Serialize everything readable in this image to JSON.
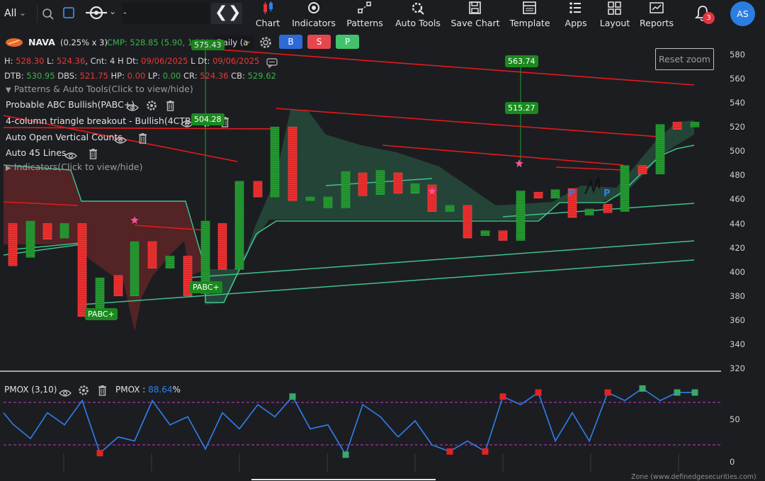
{
  "topbar": {
    "symbol_filter": "All",
    "search_value": "-",
    "menu": [
      {
        "label": "Chart",
        "icon": "candlestick-icon"
      },
      {
        "label": "Indicators",
        "icon": "indicators-icon"
      },
      {
        "label": "Patterns",
        "icon": "patterns-icon"
      },
      {
        "label": "Auto Tools",
        "icon": "auto-tools-icon"
      },
      {
        "label": "Save Chart",
        "icon": "save-icon"
      },
      {
        "label": "Template",
        "icon": "template-icon"
      },
      {
        "label": "Apps",
        "icon": "apps-icon"
      },
      {
        "label": "Layout",
        "icon": "layout-icon"
      },
      {
        "label": "Reports",
        "icon": "reports-icon"
      }
    ],
    "notification_count": "3",
    "avatar_initials": "AS"
  },
  "header": {
    "symbol": "NAVA",
    "multiplier": "(0.25% x 3)",
    "cmp": "CMP: 528.85 (5.90, 1.13%)",
    "timeframe": "Daily (a",
    "buttons": {
      "buy": "B",
      "sell": "S",
      "p": "P"
    }
  },
  "ohlc": {
    "h_label": "H:",
    "h": "528.30",
    "l_label": "L:",
    "l": "524.36",
    "cnt": "Cnt: 4",
    "hdt_label": "H Dt:",
    "hdt": "09/06/2025",
    "ldt_label": "L Dt:",
    "ldt": "09/06/2025",
    "dtb_label": "DTB:",
    "dtb": "530.95",
    "dbs_label": "DBS:",
    "dbs": "521.75",
    "hp_label": "HP:",
    "hp": "0.00",
    "lp_label": "LP:",
    "lp": "0.00",
    "cr_label": "CR:",
    "cr": "524.36",
    "cb_label": "CB:",
    "cb": "529.62"
  },
  "panels": {
    "patterns_toggle": "Patterns & Auto Tools(Click to view/hide)",
    "items": [
      "Probable ABC Bullish(PABC+)",
      "4-column triangle breakout - Bullish(4CTB+)",
      "Auto Open Vertical Counts",
      "Auto 45 Lines"
    ],
    "indicators_toggle": "Indicators(Click to view/hide)"
  },
  "reset_zoom": "Reset zoom",
  "y_axis": [
    "580",
    "560",
    "540",
    "520",
    "500",
    "480",
    "460",
    "440",
    "420",
    "400",
    "380",
    "360",
    "340",
    "320"
  ],
  "annotations": {
    "top_clip": "575.43",
    "mid_clip": "504.28",
    "v1": "563.74",
    "v2": "515.27",
    "pabc_a": "PABC+",
    "pabc_b": "PABC+",
    "p_mark": "P"
  },
  "pmox": {
    "label": "PMOX (3,10)",
    "value_label": "PMOX :",
    "value": "88.64",
    "unit": "%",
    "y_axis": [
      "50",
      "0"
    ]
  },
  "footer": "Zone (www.definedgesecurities.com)",
  "colors": {
    "bull": "#1e8c2a",
    "bear": "#e02424",
    "trend": "#e31b1b",
    "support": "#3ec28a",
    "pmox_line": "#2f80ed",
    "accent": "#1565c0"
  },
  "chart_data": {
    "type": "bar",
    "title": "",
    "ylim": [
      310,
      590
    ],
    "note_bars": [
      {
        "x": 0,
        "open": 440,
        "close": 405,
        "dir": "down"
      },
      {
        "x": 1,
        "open": 412,
        "close": 442,
        "dir": "up"
      },
      {
        "x": 2,
        "open": 440,
        "close": 427,
        "dir": "down"
      },
      {
        "x": 3,
        "open": 428,
        "close": 440,
        "dir": "up"
      },
      {
        "x": 4,
        "open": 440,
        "close": 363,
        "dir": "down"
      },
      {
        "x": 5,
        "open": 363,
        "close": 395,
        "dir": "up"
      },
      {
        "x": 6,
        "open": 380,
        "close": 397,
        "dir": "down"
      },
      {
        "x": 7,
        "open": 380,
        "close": 425,
        "dir": "up"
      },
      {
        "x": 8,
        "open": 425,
        "close": 403,
        "dir": "down"
      },
      {
        "x": 9,
        "open": 403,
        "close": 413,
        "dir": "up"
      },
      {
        "x": 10,
        "open": 413,
        "close": 380,
        "dir": "down"
      },
      {
        "x": 11,
        "open": 382,
        "close": 442,
        "dir": "up"
      },
      {
        "x": 12,
        "open": 440,
        "close": 402,
        "dir": "down"
      },
      {
        "x": 13,
        "open": 402,
        "close": 475,
        "dir": "up"
      },
      {
        "x": 14,
        "open": 475,
        "close": 462,
        "dir": "down"
      },
      {
        "x": 15,
        "open": 462,
        "close": 520,
        "dir": "up"
      },
      {
        "x": 16,
        "open": 520,
        "close": 459,
        "dir": "down"
      },
      {
        "x": 17,
        "open": 459,
        "close": 462,
        "dir": "up"
      },
      {
        "x": 18,
        "open": 462,
        "close": 453,
        "dir": "up"
      },
      {
        "x": 19,
        "open": 453,
        "close": 483,
        "dir": "up"
      },
      {
        "x": 20,
        "open": 482,
        "close": 463,
        "dir": "down"
      },
      {
        "x": 21,
        "open": 464,
        "close": 484,
        "dir": "up"
      },
      {
        "x": 22,
        "open": 482,
        "close": 465,
        "dir": "down"
      },
      {
        "x": 23,
        "open": 465,
        "close": 473,
        "dir": "up"
      },
      {
        "x": 24,
        "open": 472,
        "close": 450,
        "dir": "down"
      },
      {
        "x": 25,
        "open": 455,
        "close": 450,
        "dir": "up"
      },
      {
        "x": 26,
        "open": 455,
        "close": 428,
        "dir": "down"
      },
      {
        "x": 27,
        "open": 430,
        "close": 434,
        "dir": "up"
      },
      {
        "x": 28,
        "open": 434,
        "close": 426,
        "dir": "down"
      },
      {
        "x": 29,
        "open": 426,
        "close": 467,
        "dir": "up"
      },
      {
        "x": 30,
        "open": 466,
        "close": 461,
        "dir": "down"
      },
      {
        "x": 31,
        "open": 461,
        "close": 468,
        "dir": "up"
      },
      {
        "x": 32,
        "open": 469,
        "close": 445,
        "dir": "down"
      },
      {
        "x": 33,
        "open": 447,
        "close": 452,
        "dir": "up"
      },
      {
        "x": 34,
        "open": 456,
        "close": 449,
        "dir": "down"
      },
      {
        "x": 35,
        "open": 450,
        "close": 488,
        "dir": "up"
      },
      {
        "x": 36,
        "open": 488,
        "close": 481,
        "dir": "down"
      },
      {
        "x": 37,
        "open": 481,
        "close": 522,
        "dir": "up"
      },
      {
        "x": 38,
        "open": 524,
        "close": 518,
        "dir": "down"
      },
      {
        "x": 39,
        "open": 520,
        "close": 524,
        "dir": "up"
      }
    ],
    "pmox_values": [
      46,
      28,
      60,
      45,
      75,
      10,
      30,
      25,
      75,
      45,
      55,
      15,
      60,
      40,
      70,
      55,
      80,
      40,
      45,
      8,
      70,
      55,
      30,
      50,
      20,
      12,
      25,
      12,
      80,
      70,
      85,
      25,
      60,
      25,
      85,
      75,
      90,
      75,
      85,
      85
    ]
  }
}
